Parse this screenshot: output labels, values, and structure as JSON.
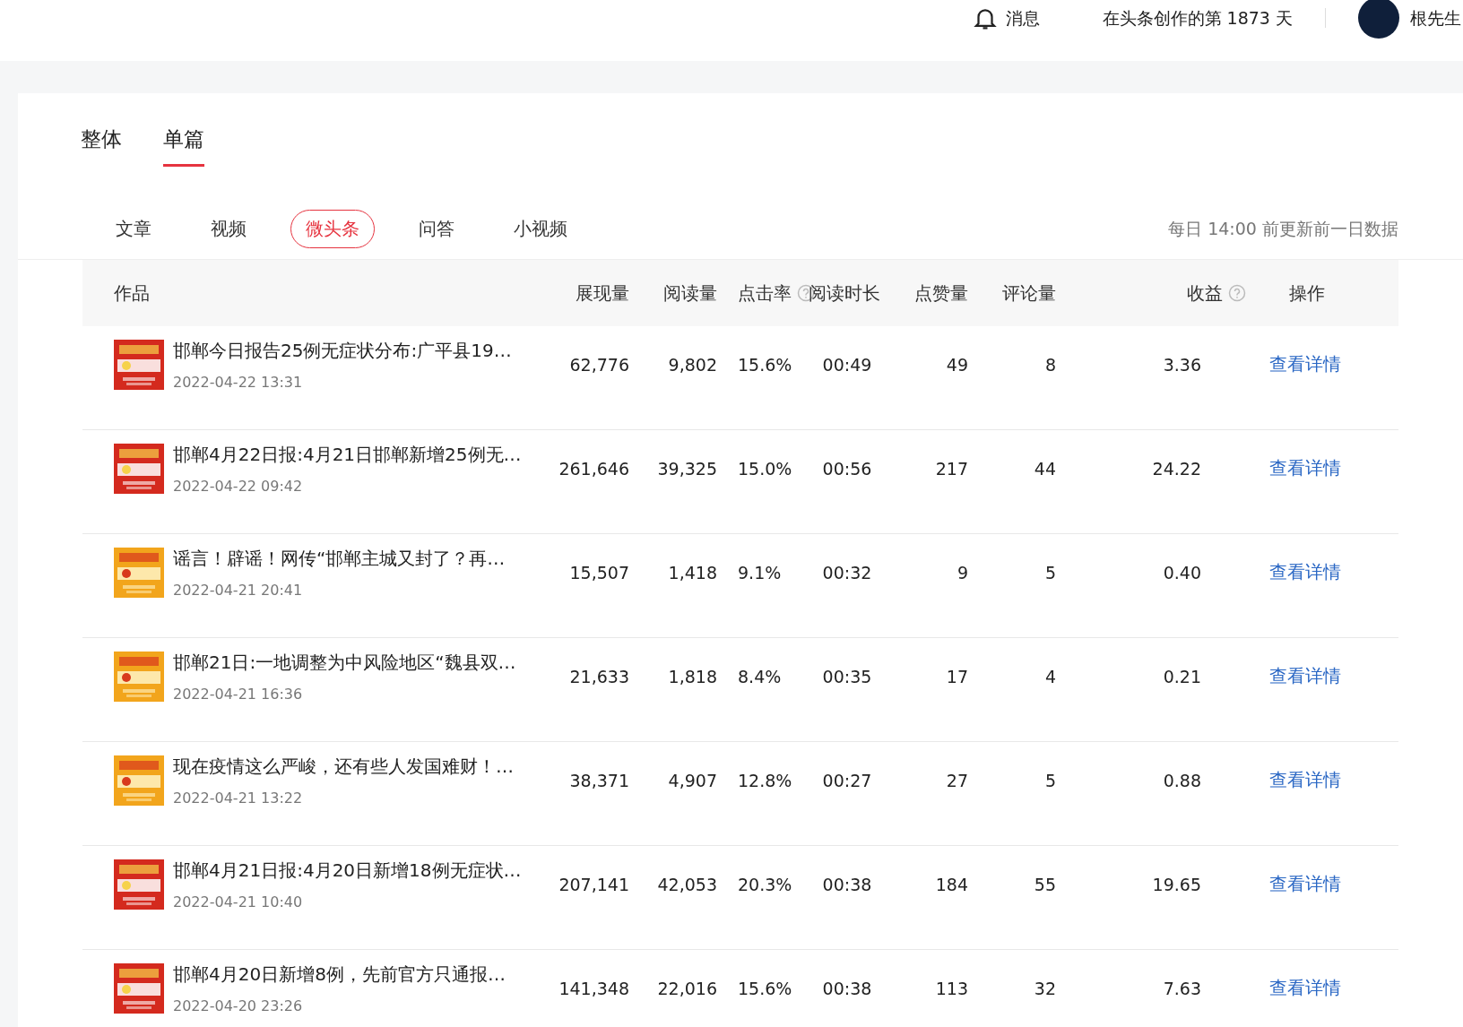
{
  "top_bar": {
    "messages": "消息",
    "days": "在头条创作的第 1873 天",
    "user": "根先生"
  },
  "main_tabs": [
    {
      "label": "整体",
      "selected": false
    },
    {
      "label": "单篇",
      "selected": true
    }
  ],
  "sub_tabs": [
    {
      "label": "文章",
      "selected": false
    },
    {
      "label": "视频",
      "selected": false
    },
    {
      "label": "微头条",
      "selected": true
    },
    {
      "label": "问答",
      "selected": false
    },
    {
      "label": "小视频",
      "selected": false
    }
  ],
  "update_note": "每日 14:00 前更新前一日数据",
  "table": {
    "columns": [
      {
        "label": "作品",
        "kind": "plain"
      },
      {
        "label": "展现量",
        "kind": "plain"
      },
      {
        "label": "阅读量",
        "kind": "plain"
      },
      {
        "label": "点击率",
        "kind": "help"
      },
      {
        "label": "阅读时长",
        "kind": "plain"
      },
      {
        "label": "点赞量",
        "kind": "plain"
      },
      {
        "label": "评论量",
        "kind": "plain"
      },
      {
        "label": "收益",
        "kind": "help"
      },
      {
        "label": "操作",
        "kind": "plain"
      }
    ],
    "rows": [
      {
        "thumbnail": {
          "kind": "red"
        },
        "title": "邯郸今日报告25例无症状分布:广平县19…",
        "date": "2022-04-22 13:31",
        "impressions": "62,776",
        "reads": "9,802",
        "ctr": "15.6%",
        "read_time": "00:49",
        "likes": "49",
        "comments": "8",
        "revenue": "3.36",
        "action": "查看详情"
      },
      {
        "thumbnail": {
          "kind": "red"
        },
        "title": "邯郸4月22日报:4月21日邯郸新增25例无…",
        "date": "2022-04-22 09:42",
        "impressions": "261,646",
        "reads": "39,325",
        "ctr": "15.0%",
        "read_time": "00:56",
        "likes": "217",
        "comments": "44",
        "revenue": "24.22",
        "action": "查看详情"
      },
      {
        "thumbnail": {
          "kind": "orange"
        },
        "title": "谣言！辟谣！网传“邯郸主城又封了？再…",
        "date": "2022-04-21 20:41",
        "impressions": "15,507",
        "reads": "1,418",
        "ctr": "9.1%",
        "read_time": "00:32",
        "likes": "9",
        "comments": "5",
        "revenue": "0.40",
        "action": "查看详情"
      },
      {
        "thumbnail": {
          "kind": "orange"
        },
        "title": "邯郸21日:一地调整为中风险地区“魏县双…",
        "date": "2022-04-21 16:36",
        "impressions": "21,633",
        "reads": "1,818",
        "ctr": "8.4%",
        "read_time": "00:35",
        "likes": "17",
        "comments": "4",
        "revenue": "0.21",
        "action": "查看详情"
      },
      {
        "thumbnail": {
          "kind": "orange"
        },
        "title": "现在疫情这么严峻，还有些人发国难财！…",
        "date": "2022-04-21 13:22",
        "impressions": "38,371",
        "reads": "4,907",
        "ctr": "12.8%",
        "read_time": "00:27",
        "likes": "27",
        "comments": "5",
        "revenue": "0.88",
        "action": "查看详情"
      },
      {
        "thumbnail": {
          "kind": "red"
        },
        "title": "邯郸4月21日报:4月20日新增18例无症状…",
        "date": "2022-04-21 10:40",
        "impressions": "207,141",
        "reads": "42,053",
        "ctr": "20.3%",
        "read_time": "00:38",
        "likes": "184",
        "comments": "55",
        "revenue": "19.65",
        "action": "查看详情"
      },
      {
        "thumbnail": {
          "kind": "red"
        },
        "title": "邯郸4月20日新增8例，先前官方只通报…",
        "date": "2022-04-20 23:26",
        "impressions": "141,348",
        "reads": "22,016",
        "ctr": "15.6%",
        "read_time": "00:38",
        "likes": "113",
        "comments": "32",
        "revenue": "7.63",
        "action": "查看详情"
      }
    ]
  }
}
